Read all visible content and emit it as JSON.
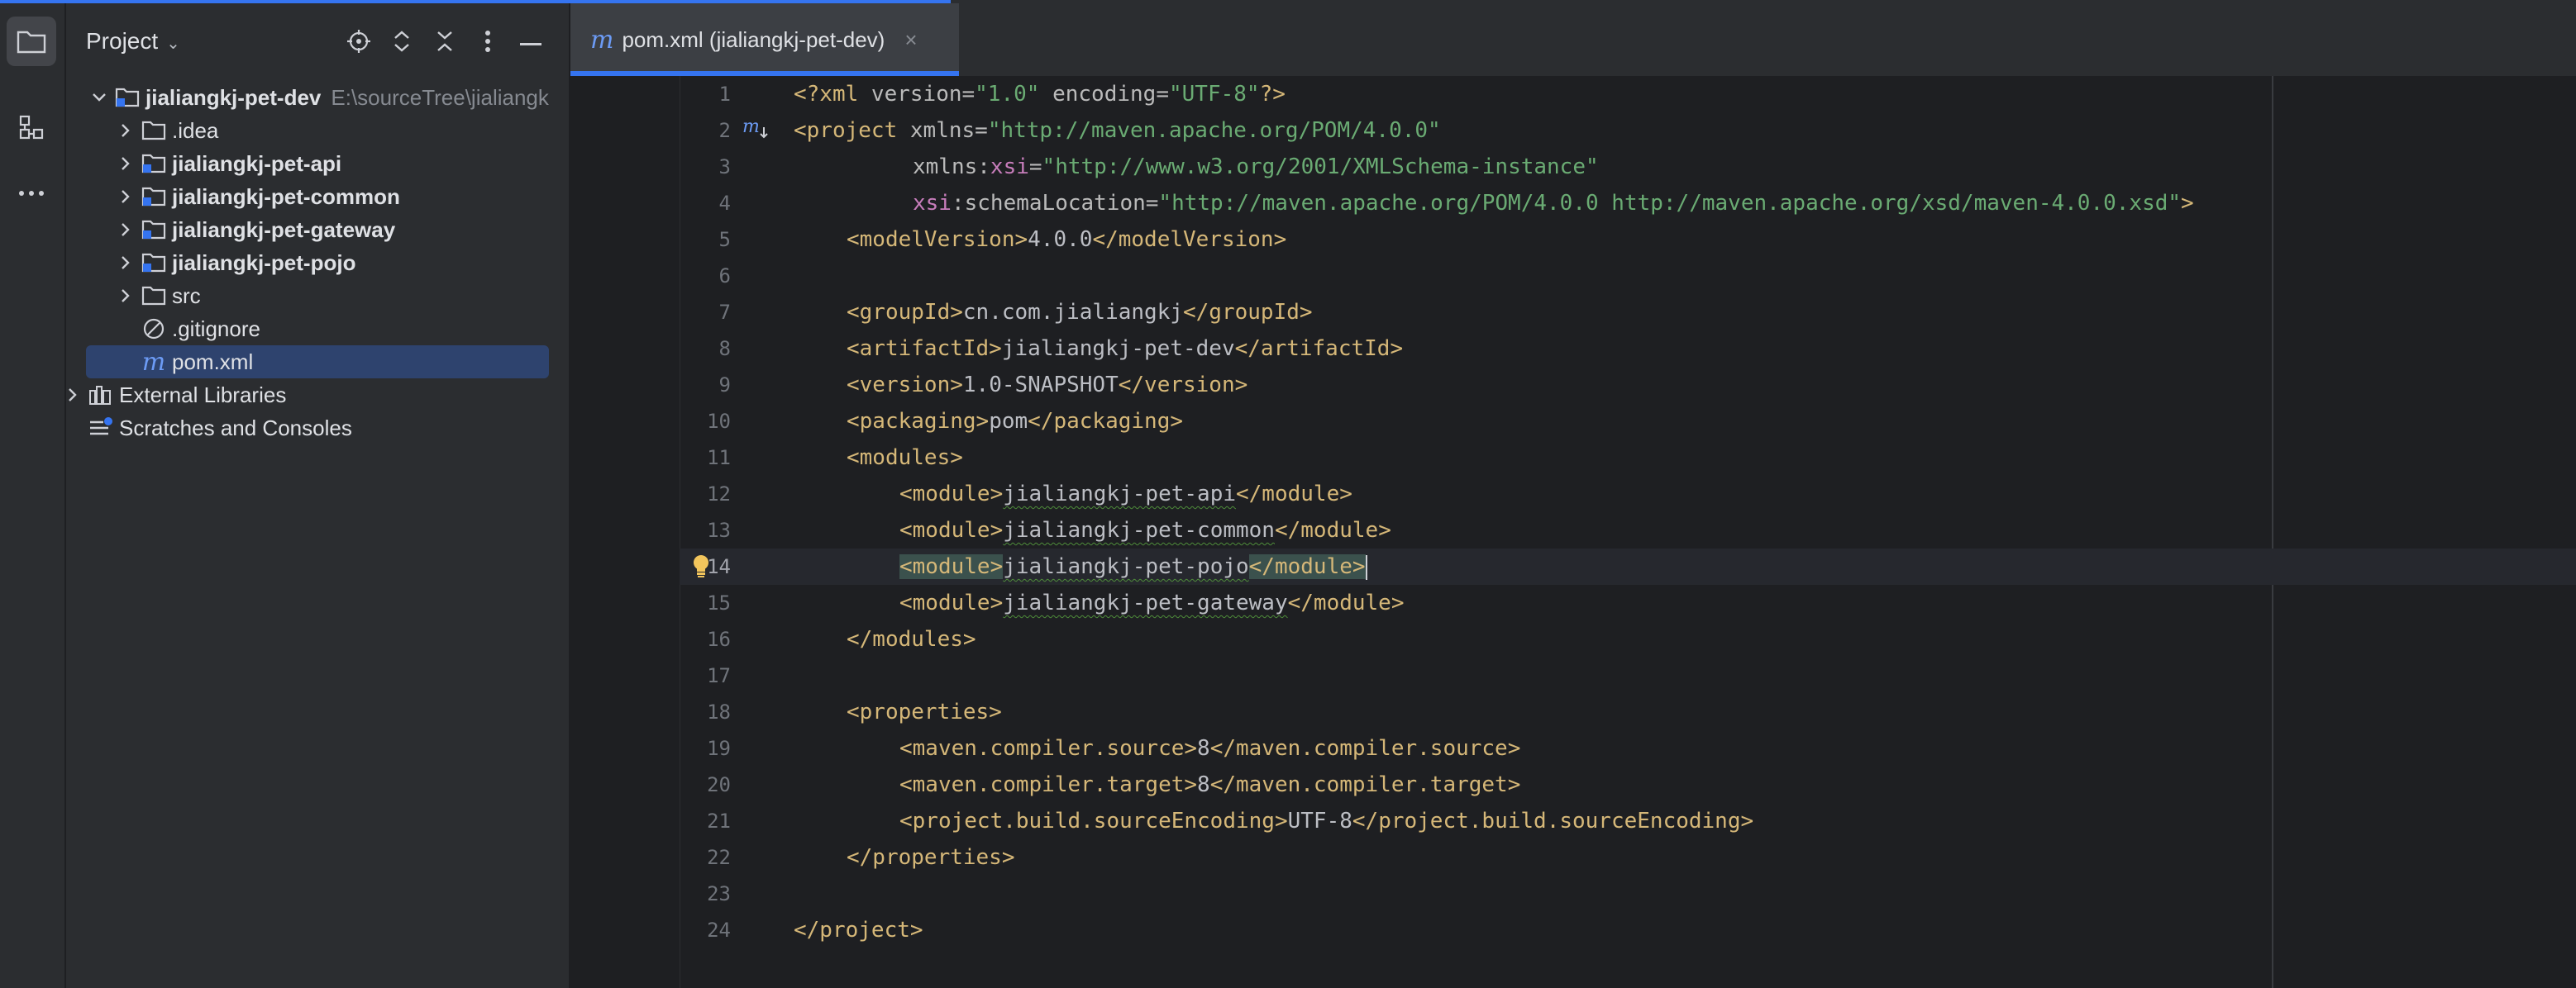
{
  "project_panel": {
    "title": "Project",
    "tree": [
      {
        "label": "jialiangkj-pet-dev",
        "hint": "E:\\sourceTree\\jialiangk",
        "depth": 0,
        "expanded": true,
        "icon": "module-folder-icon",
        "bold": true
      },
      {
        "label": ".idea",
        "depth": 1,
        "icon": "folder-icon"
      },
      {
        "label": "jialiangkj-pet-api",
        "depth": 1,
        "icon": "module-folder-icon",
        "bold": true
      },
      {
        "label": "jialiangkj-pet-common",
        "depth": 1,
        "icon": "module-folder-icon",
        "bold": true
      },
      {
        "label": "jialiangkj-pet-gateway",
        "depth": 1,
        "icon": "module-folder-icon",
        "bold": true
      },
      {
        "label": "jialiangkj-pet-pojo",
        "depth": 1,
        "icon": "module-folder-icon",
        "bold": true
      },
      {
        "label": "src",
        "depth": 1,
        "icon": "folder-icon"
      },
      {
        "label": ".gitignore",
        "depth": 1,
        "icon": "ignore-file-icon"
      },
      {
        "label": "pom.xml",
        "depth": 1,
        "icon": "maven-icon",
        "selected": true
      },
      {
        "label": "External Libraries",
        "depth": 0,
        "icon": "libraries-icon"
      },
      {
        "label": "Scratches and Consoles",
        "depth": 0,
        "icon": "scratches-icon"
      }
    ]
  },
  "editor": {
    "tab_label": "pom.xml (jialiangkj-pet-dev)",
    "tab_icon": "m",
    "tab_close": "×",
    "current_line": 14,
    "lines": [
      {
        "n": "1"
      },
      {
        "n": "2"
      },
      {
        "n": "3"
      },
      {
        "n": "4"
      },
      {
        "n": "5"
      },
      {
        "n": "6"
      },
      {
        "n": "7"
      },
      {
        "n": "8"
      },
      {
        "n": "9"
      },
      {
        "n": "10"
      },
      {
        "n": "11"
      },
      {
        "n": "12"
      },
      {
        "n": "13"
      },
      {
        "n": "14"
      },
      {
        "n": "15"
      },
      {
        "n": "16"
      },
      {
        "n": "17"
      },
      {
        "n": "18"
      },
      {
        "n": "19"
      },
      {
        "n": "20"
      },
      {
        "n": "21"
      },
      {
        "n": "22"
      },
      {
        "n": "23"
      },
      {
        "n": "24"
      }
    ],
    "code": {
      "xml_decl_open": "<?xml ",
      "xml_version_attr": "version=",
      "xml_version_val": "\"1.0\"",
      "xml_encoding_attr": " encoding=",
      "xml_encoding_val": "\"UTF-8\"",
      "xml_decl_close": "?>",
      "project_open": "<project ",
      "xmlns_attr": "xmlns=",
      "xmlns_val": "\"http://maven.apache.org/POM/4.0.0\"",
      "xmlns_xsi_prefix": "xmlns:",
      "xsi": "xsi",
      "xmlns_xsi_eq": "=",
      "xmlns_xsi_val": "\"http://www.w3.org/2001/XMLSchema-instance\"",
      "schema_attr": ":schemaLocation=",
      "schema_val": "\"http://maven.apache.org/POM/4.0.0 http://maven.apache.org/xsd/maven-4.0.0.xsd\"",
      "gt": ">",
      "modelVersion_open": "<modelVersion>",
      "modelVersion_val": "4.0.0",
      "modelVersion_close": "</modelVersion>",
      "groupId_open": "<groupId>",
      "groupId_val": "cn.com.jialiangkj",
      "groupId_close": "</groupId>",
      "artifactId_open": "<artifactId>",
      "artifactId_val": "jialiangkj-pet-dev",
      "artifactId_close": "</artifactId>",
      "version_open": "<version>",
      "version_val": "1.0-SNAPSHOT",
      "version_close": "</version>",
      "packaging_open": "<packaging>",
      "packaging_val": "pom",
      "packaging_close": "</packaging>",
      "modules_open": "<modules>",
      "module_open": "<module>",
      "module_close": "</module>",
      "module_1": "jialiangkj-pet-api",
      "module_2": "jialiangkj-pet-common",
      "module_3": "jialiangkj-pet-pojo",
      "module_4": "jialiangkj-pet-gateway",
      "modules_close": "</modules>",
      "properties_open": "<properties>",
      "src_open": "<maven.compiler.source>",
      "src_val": "8",
      "src_close": "</maven.compiler.source>",
      "tgt_open": "<maven.compiler.target>",
      "tgt_val": "8",
      "tgt_close": "</maven.compiler.target>",
      "enc_open": "<project.build.sourceEncoding>",
      "enc_val": "UTF-8",
      "enc_close": "</project.build.sourceEncoding>",
      "properties_close": "</properties>",
      "project_close": "</project>"
    }
  },
  "colors": {
    "accent": "#3574f0",
    "tag": "#d5b778",
    "string": "#6aab73",
    "namespace": "#c77dbb",
    "selection": "#2e436e"
  }
}
